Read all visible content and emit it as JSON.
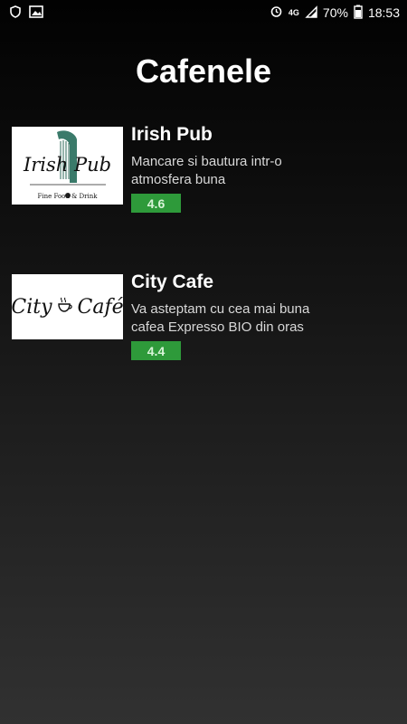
{
  "status_bar": {
    "network": "4G",
    "battery": "70%",
    "time": "18:53"
  },
  "page": {
    "title": "Cafenele"
  },
  "cafes": [
    {
      "name": "Irish Pub",
      "description": "Mancare si bautura intr-o atmosfera buna",
      "rating": "4.6",
      "logo": {
        "main": "Irish Pub",
        "tagline": "Fine Food & Drink"
      }
    },
    {
      "name": "City Cafe",
      "description": "Va asteptam cu cea mai buna cafea Expresso BIO din oras",
      "rating": "4.4",
      "logo": {
        "left": "City",
        "right": "Café"
      }
    }
  ],
  "colors": {
    "rating_bg": "#2e9a3a"
  }
}
